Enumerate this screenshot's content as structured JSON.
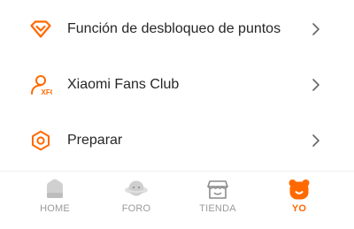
{
  "menu": {
    "items": [
      {
        "label": "Función de desbloqueo de puntos",
        "icon": "diamond-icon"
      },
      {
        "label": "Xiaomi Fans Club",
        "icon": "fans-club-person-icon"
      },
      {
        "label": "Preparar",
        "icon": "settings-hex-icon"
      }
    ],
    "chevron_icon": "chevron-right-icon"
  },
  "tabbar": {
    "tabs": [
      {
        "label": "HOME",
        "icon": "home-icon",
        "active": false
      },
      {
        "label": "FORO",
        "icon": "planet-forum-icon",
        "active": false
      },
      {
        "label": "TIENDA",
        "icon": "store-icon",
        "active": false
      },
      {
        "label": "YO",
        "icon": "bear-profile-icon",
        "active": true
      }
    ]
  },
  "colors": {
    "accent": "#ff6900",
    "inactive_icon": "#d0d0d0",
    "text": "#262626",
    "chevron": "#666666"
  }
}
